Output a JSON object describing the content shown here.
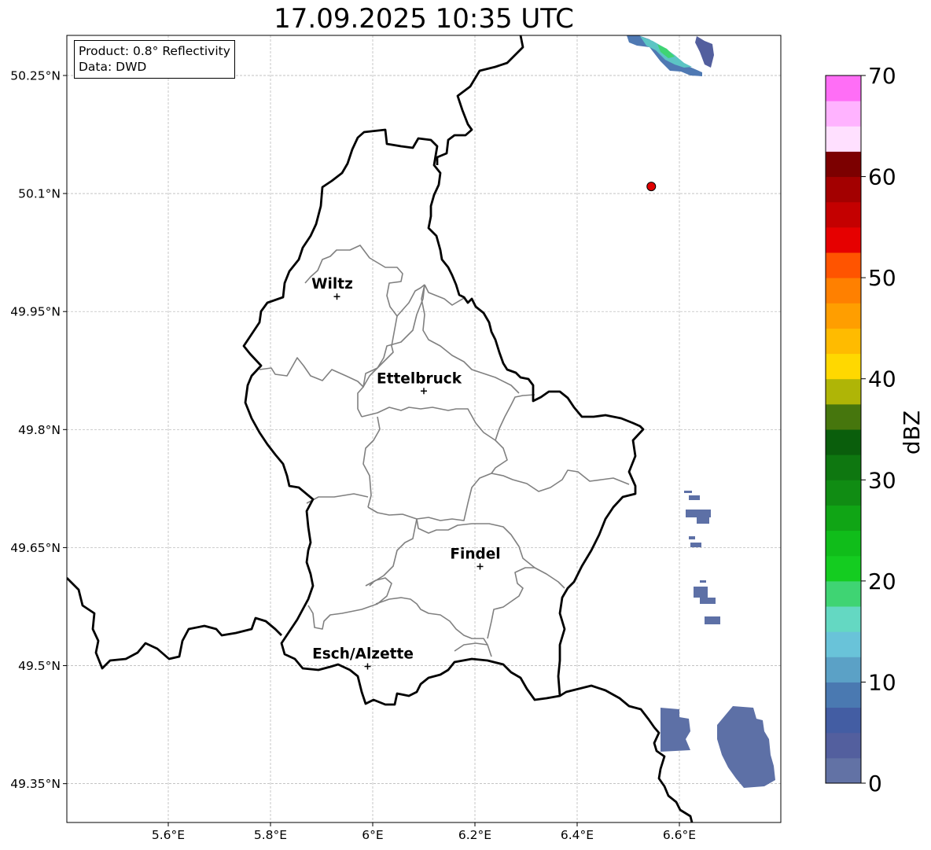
{
  "title": "17.09.2025 10:35 UTC",
  "info": {
    "product": "Product: 0.8° Reflectivity",
    "source": "Data: DWD"
  },
  "axes": {
    "lon_ticks": [
      "5.6°E",
      "5.8°E",
      "6°E",
      "6.2°E",
      "6.4°E",
      "6.6°E"
    ],
    "lat_ticks": [
      "50.25°N",
      "50.1°N",
      "49.95°N",
      "49.8°N",
      "49.65°N",
      "49.5°N",
      "49.35°N"
    ],
    "grid": true
  },
  "cities": [
    {
      "name": "Wiltz",
      "lon": 5.93,
      "lat": 49.969
    },
    {
      "name": "Ettelbruck",
      "lon": 6.1,
      "lat": 49.849
    },
    {
      "name": "Findel",
      "lon": 6.21,
      "lat": 49.626
    },
    {
      "name": "Esch/Alzette",
      "lon": 5.99,
      "lat": 49.499
    }
  ],
  "marker": {
    "lon": 6.545,
    "lat": 50.109,
    "color": "#e00000"
  },
  "colorbar": {
    "label": "dBZ",
    "ticks": [
      "0",
      "10",
      "20",
      "30",
      "40",
      "50",
      "60",
      "70"
    ],
    "min": 0,
    "max": 70,
    "step": 2.5,
    "colors": [
      "#6272a5",
      "#535f9e",
      "#435da3",
      "#4a79b1",
      "#5ba1c6",
      "#69c3d9",
      "#64d8c2",
      "#3fd473",
      "#14cc20",
      "#10bd1a",
      "#10a515",
      "#108c13",
      "#0e7710",
      "#0a5e0c",
      "#46760d",
      "#afb506",
      "#ffd800",
      "#ffbb00",
      "#ff9e00",
      "#ff8000",
      "#ff5400",
      "#e60000",
      "#c40000",
      "#a30000",
      "#7c0000",
      "#ffe0ff",
      "#ffb3ff",
      "#ff6ef6",
      "#ee36ee"
    ]
  }
}
